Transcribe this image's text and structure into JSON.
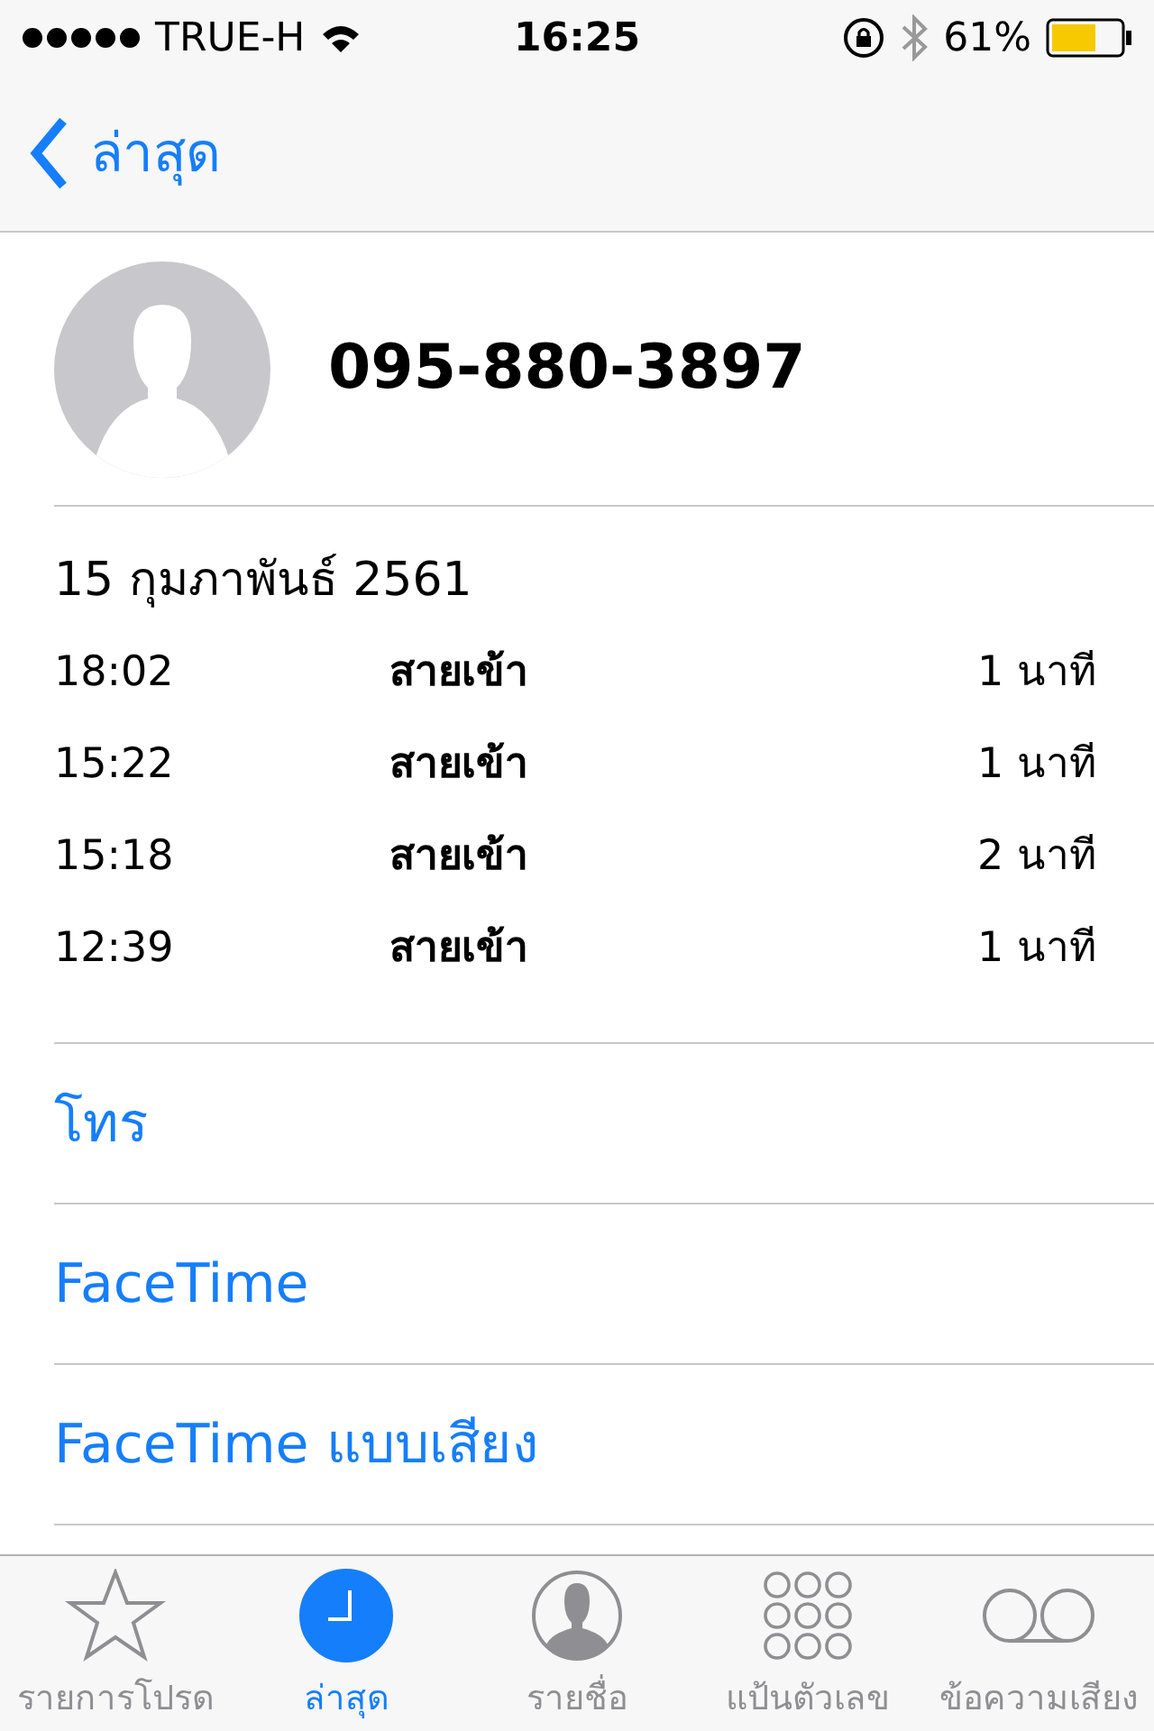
{
  "status_bar": {
    "carrier": "TRUE-H",
    "time": "16:25",
    "battery": "61%"
  },
  "nav": {
    "back": "ล่าสุด"
  },
  "contact": {
    "number": "095-880-3897"
  },
  "calls": {
    "date": "15 กุมภาพันธ์ 2561",
    "rows": [
      {
        "time": "18:02",
        "type": "สายเข้า",
        "duration": "1 นาที"
      },
      {
        "time": "15:22",
        "type": "สายเข้า",
        "duration": "1 นาที"
      },
      {
        "time": "15:18",
        "type": "สายเข้า",
        "duration": "2 นาที"
      },
      {
        "time": "12:39",
        "type": "สายเข้า",
        "duration": "1 นาที"
      }
    ]
  },
  "actions": [
    "โทร",
    "FaceTime",
    "FaceTime แบบเสียง"
  ],
  "tab_bar": [
    {
      "kind": "favorites",
      "label": "รายการโปรด",
      "selected": false
    },
    {
      "kind": "recents",
      "label": "ล่าสุด",
      "selected": true
    },
    {
      "kind": "contacts",
      "label": "รายชื่อ",
      "selected": false
    },
    {
      "kind": "keypad",
      "label": "แป้นตัวเลข",
      "selected": false
    },
    {
      "kind": "voicemail",
      "label": "ข้อความเสียง",
      "selected": false
    }
  ]
}
